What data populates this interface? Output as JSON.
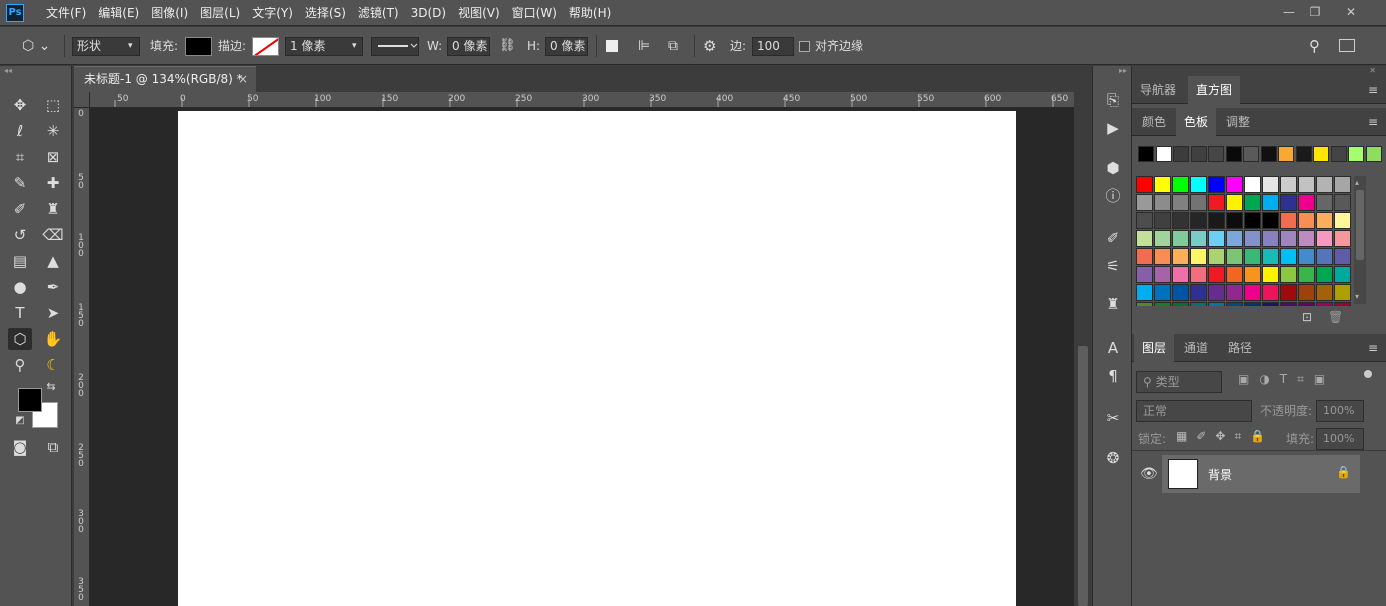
{
  "app": {
    "logo_text": "Ps"
  },
  "menu": [
    "文件(F)",
    "编辑(E)",
    "图像(I)",
    "图层(L)",
    "文字(Y)",
    "选择(S)",
    "滤镜(T)",
    "3D(D)",
    "视图(V)",
    "窗口(W)",
    "帮助(H)"
  ],
  "window_controls": {
    "minimize": "—",
    "restore": "❐",
    "close": "✕"
  },
  "options_bar": {
    "shape_mode": "形状",
    "fill_label": "填充:",
    "stroke_label": "描边:",
    "stroke_width": "1 像素",
    "w_label": "W:",
    "w_value": "0 像素",
    "h_label": "H:",
    "h_value": "0 像素",
    "sides_label": "边:",
    "sides_value": "100",
    "align_edges_label": "对齐边缘"
  },
  "document_tab": {
    "title": "未标题-1 @ 134%(RGB/8) *",
    "close": "×"
  },
  "ruler_h": [
    "50",
    "0",
    "50",
    "100",
    "150",
    "200",
    "250",
    "300",
    "350",
    "400",
    "450",
    "500",
    "550",
    "600",
    "650"
  ],
  "ruler_v": [
    "0",
    "5\n0",
    "1\n0\n0",
    "1\n5\n0",
    "2\n0\n0",
    "2\n5\n0",
    "3\n0\n0",
    "3\n5\n0"
  ],
  "colors": {
    "foreground": "#000000",
    "background": "#ffffff",
    "ps_blue": "#31a8ff"
  },
  "panels": {
    "top_tabs": [
      "导航器",
      "直方图"
    ],
    "swatch_tabs": [
      "颜色",
      "色板",
      "调整"
    ],
    "layer_tabs": [
      "图层",
      "通道",
      "路径"
    ]
  },
  "recent_swatches": [
    "#000000",
    "#ffffff",
    "#3c3c3c",
    "#404040",
    "#474747",
    "#0a0a0a",
    "#5a5a5a",
    "#111111",
    "#f7a934",
    "#1a1a1a",
    "#ffe600",
    "#444444",
    "#a3ff6b",
    "#8fdd60"
  ],
  "swatches": [
    [
      "#ff0000",
      "#ffff00",
      "#00ff00",
      "#00ffff",
      "#0000ff",
      "#ff00ff",
      "#ffffff",
      "#e5e5e5",
      "#cccccc",
      "#c2c2c2",
      "#b3b3b3",
      "#a6a6a6"
    ],
    [
      "#999999",
      "#8c8c8c",
      "#808080",
      "#737373",
      "#ed1c24",
      "#fff200",
      "#00a651",
      "#00aeef",
      "#2e3192",
      "#ec008c",
      "#666666",
      "#595959"
    ],
    [
      "#4d4d4d",
      "#404040",
      "#333333",
      "#262626",
      "#1a1a1a",
      "#0d0d0d",
      "#000000",
      "#000000",
      "#f26c4f",
      "#f68e56",
      "#fbaf5d",
      "#fff799"
    ],
    [
      "#c4df9b",
      "#a3d39c",
      "#82ca9c",
      "#7accc8",
      "#6dcff6",
      "#7da7d9",
      "#8393ca",
      "#8781bd",
      "#a186be",
      "#bd8cbf",
      "#f49ac1",
      "#f5989d"
    ],
    [
      "#f26c4f",
      "#f68e56",
      "#fbaf5d",
      "#fff568",
      "#acd373",
      "#7cc576",
      "#3bb878",
      "#1abbb4",
      "#00bff3",
      "#438ccb",
      "#5574b9",
      "#605ca8"
    ],
    [
      "#855fa8",
      "#a763a8",
      "#f06eaa",
      "#f26d7d",
      "#ed1c24",
      "#f26522",
      "#f7941d",
      "#fff200",
      "#8dc63f",
      "#39b54a",
      "#00a651",
      "#00a99d"
    ],
    [
      "#00aeef",
      "#0072bc",
      "#0054a6",
      "#2e3192",
      "#662d91",
      "#92278f",
      "#ec008c",
      "#ed145b",
      "#9e0b0f",
      "#a0410d",
      "#a36209",
      "#aba000"
    ],
    [
      "#598527",
      "#197b30",
      "#007236",
      "#00746b",
      "#0076a3",
      "#004a80",
      "#003471",
      "#1b1464",
      "#440e62",
      "#630460",
      "#9e005d",
      "#9e0039"
    ]
  ],
  "layers": {
    "search_placeholder": "类型",
    "blend_mode": "正常",
    "opacity_label": "不透明度:",
    "opacity_value": "100%",
    "lock_label": "锁定:",
    "fill_label": "填充:",
    "fill_value": "100%",
    "items": [
      {
        "name": "背景",
        "visible": true,
        "locked": true
      }
    ]
  }
}
